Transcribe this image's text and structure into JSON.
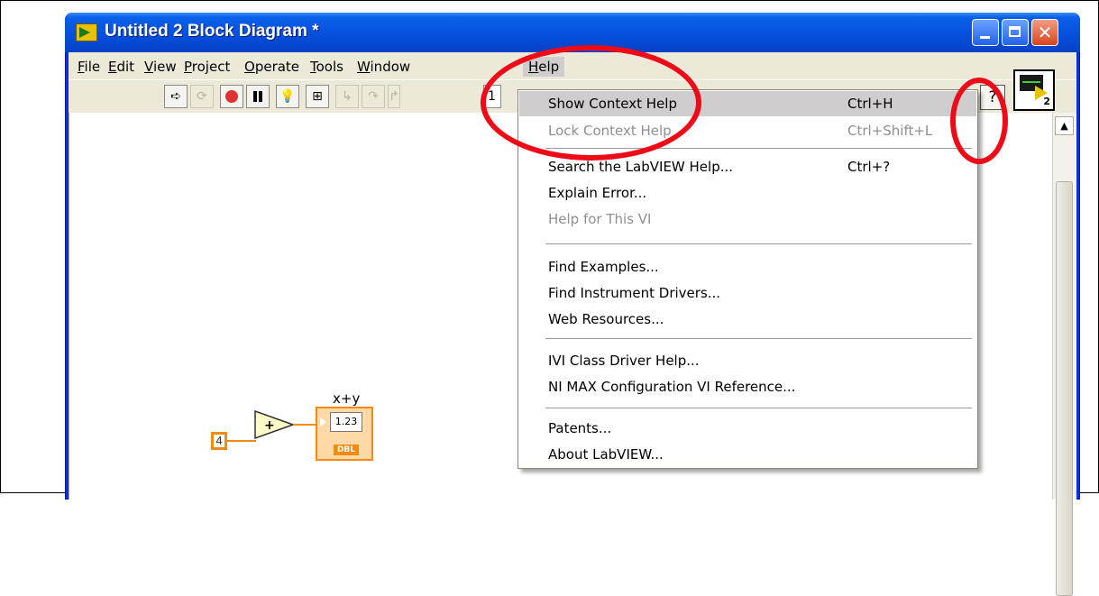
{
  "window": {
    "title": "Untitled 2 Block Diagram *"
  },
  "menubar": {
    "items": [
      "File",
      "Edit",
      "View",
      "Project",
      "Operate",
      "Tools",
      "Window",
      "Help"
    ]
  },
  "toolbar": {
    "font_size_value": "1",
    "help_icon": "?",
    "vi_icon_number": "2"
  },
  "diagram": {
    "constant_value": "4",
    "add_symbol": "+",
    "indicator_label": "x+y",
    "indicator_value": "1.23",
    "indicator_type": "DBL"
  },
  "help_menu": {
    "items": [
      {
        "label": "Show Context Help",
        "shortcut": "Ctrl+H",
        "enabled": true,
        "highlighted": true
      },
      {
        "label": "Lock Context Help",
        "shortcut": "Ctrl+Shift+L",
        "enabled": false
      },
      {
        "separator": true
      },
      {
        "label": "Search the LabVIEW Help...",
        "shortcut": "Ctrl+?",
        "enabled": true
      },
      {
        "label": "Explain Error...",
        "shortcut": "",
        "enabled": true
      },
      {
        "label": "Help for This VI",
        "shortcut": "",
        "enabled": false
      },
      {
        "separator": true
      },
      {
        "label": "Find Examples...",
        "shortcut": "",
        "enabled": true
      },
      {
        "label": "Find Instrument Drivers...",
        "shortcut": "",
        "enabled": true
      },
      {
        "label": "Web Resources...",
        "shortcut": "",
        "enabled": true
      },
      {
        "separator": true
      },
      {
        "label": "IVI Class Driver Help...",
        "shortcut": "",
        "enabled": true
      },
      {
        "label": "NI MAX Configuration VI Reference...",
        "shortcut": "",
        "enabled": true
      },
      {
        "separator": true
      },
      {
        "label": "Patents...",
        "shortcut": "",
        "enabled": true
      },
      {
        "label": "About LabVIEW...",
        "shortcut": "",
        "enabled": true
      }
    ]
  },
  "colors": {
    "annotation": "#ee0a16",
    "wire": "#f58a10",
    "highlight": "#cfcdcd"
  }
}
